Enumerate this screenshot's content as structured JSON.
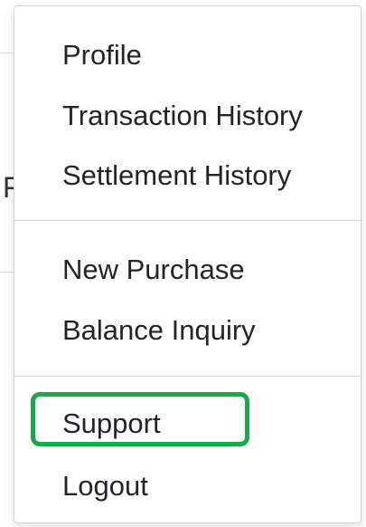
{
  "menu": {
    "items": [
      {
        "label": "Profile"
      },
      {
        "label": "Transaction History"
      },
      {
        "label": "Settlement History"
      },
      {
        "label": "New Purchase"
      },
      {
        "label": "Balance Inquiry"
      },
      {
        "label": "Support"
      },
      {
        "label": "Logout"
      }
    ],
    "highlighted_item": "Support",
    "highlight_color": "#1aa84a"
  },
  "background": {
    "partial_glyph": "F"
  }
}
